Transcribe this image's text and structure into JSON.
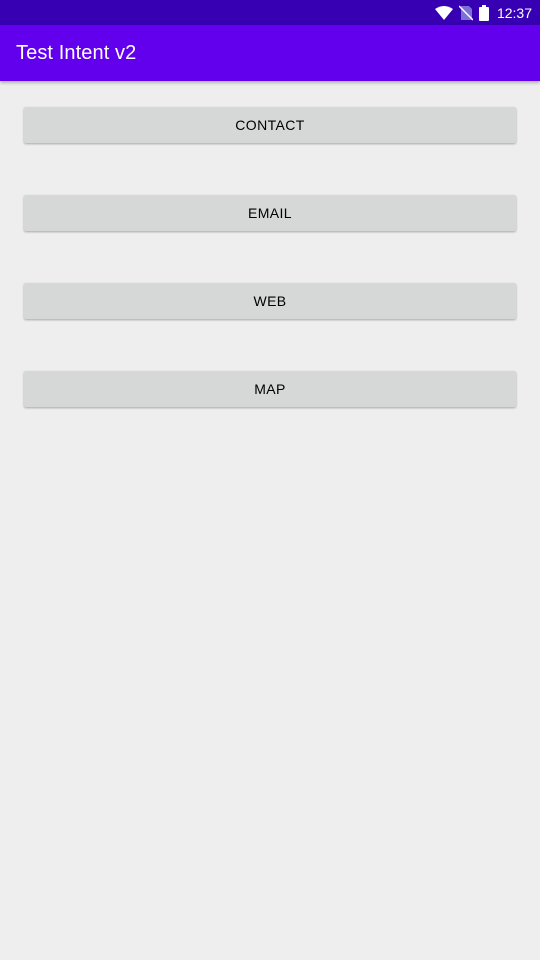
{
  "status_bar": {
    "time": "12:37",
    "icons": [
      "wifi-icon",
      "no-sim-icon",
      "battery-icon"
    ]
  },
  "app_bar": {
    "title": "Test Intent v2",
    "color": "#6200ee"
  },
  "buttons": [
    {
      "label": "CONTACT"
    },
    {
      "label": "EMAIL"
    },
    {
      "label": "WEB"
    },
    {
      "label": "MAP"
    }
  ],
  "colors": {
    "status_bar": "#3700b3",
    "background": "#eeeeee",
    "button": "#d6d7d7"
  }
}
